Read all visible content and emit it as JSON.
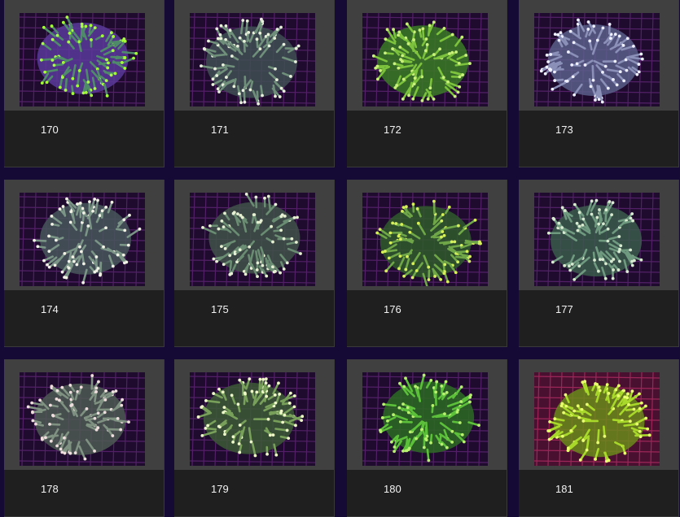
{
  "gallery": {
    "items": [
      {
        "label": "170",
        "coral": "green-tips-purple-base",
        "base": "#5b3a9a",
        "tentacle": "#4f8a6a",
        "tip": "#a4ff3a"
      },
      {
        "label": "171",
        "coral": "grey-white-tips",
        "base": "#3f4f52",
        "tentacle": "#6f8f7a",
        "tip": "#e8f0dc"
      },
      {
        "label": "172",
        "coral": "lime-green",
        "base": "#3a7a24",
        "tentacle": "#7cc23c",
        "tip": "#c8f07a"
      },
      {
        "label": "173",
        "coral": "lavender-white-tips",
        "base": "#5a5f8a",
        "tentacle": "#8a90b8",
        "tip": "#eef0ff"
      },
      {
        "label": "174",
        "coral": "grey-white-tips",
        "base": "#47575a",
        "tentacle": "#7a9486",
        "tip": "#f2f2e6"
      },
      {
        "label": "175",
        "coral": "grey-green-white-tips",
        "base": "#3f5248",
        "tentacle": "#6a8c72",
        "tip": "#e6efd2"
      },
      {
        "label": "176",
        "coral": "green-yellow-tips",
        "base": "#2f5a2a",
        "tentacle": "#6fa648",
        "tip": "#d6f05a"
      },
      {
        "label": "177",
        "coral": "grey-green",
        "base": "#3a5a4a",
        "tentacle": "#6f9a80",
        "tip": "#d8ead0"
      },
      {
        "label": "178",
        "coral": "grey-pink-tips",
        "base": "#4d5a52",
        "tentacle": "#7f9282",
        "tip": "#f0dede"
      },
      {
        "label": "179",
        "coral": "green-white-tips",
        "base": "#3c5a36",
        "tentacle": "#78a05a",
        "tip": "#eef8c8"
      },
      {
        "label": "180",
        "coral": "bright-green",
        "base": "#2c6a22",
        "tentacle": "#5cc03a",
        "tip": "#b8f070"
      },
      {
        "label": "181",
        "coral": "yellow-green-pink-background",
        "base": "#6a8a1a",
        "tentacle": "#a8d82a",
        "tip": "#eaff70"
      }
    ]
  },
  "colors": {
    "page_background": "#150a36",
    "tile_background": "#1f1f1f",
    "frame_background": "#404040",
    "caption_text": "#f2f2f2"
  }
}
